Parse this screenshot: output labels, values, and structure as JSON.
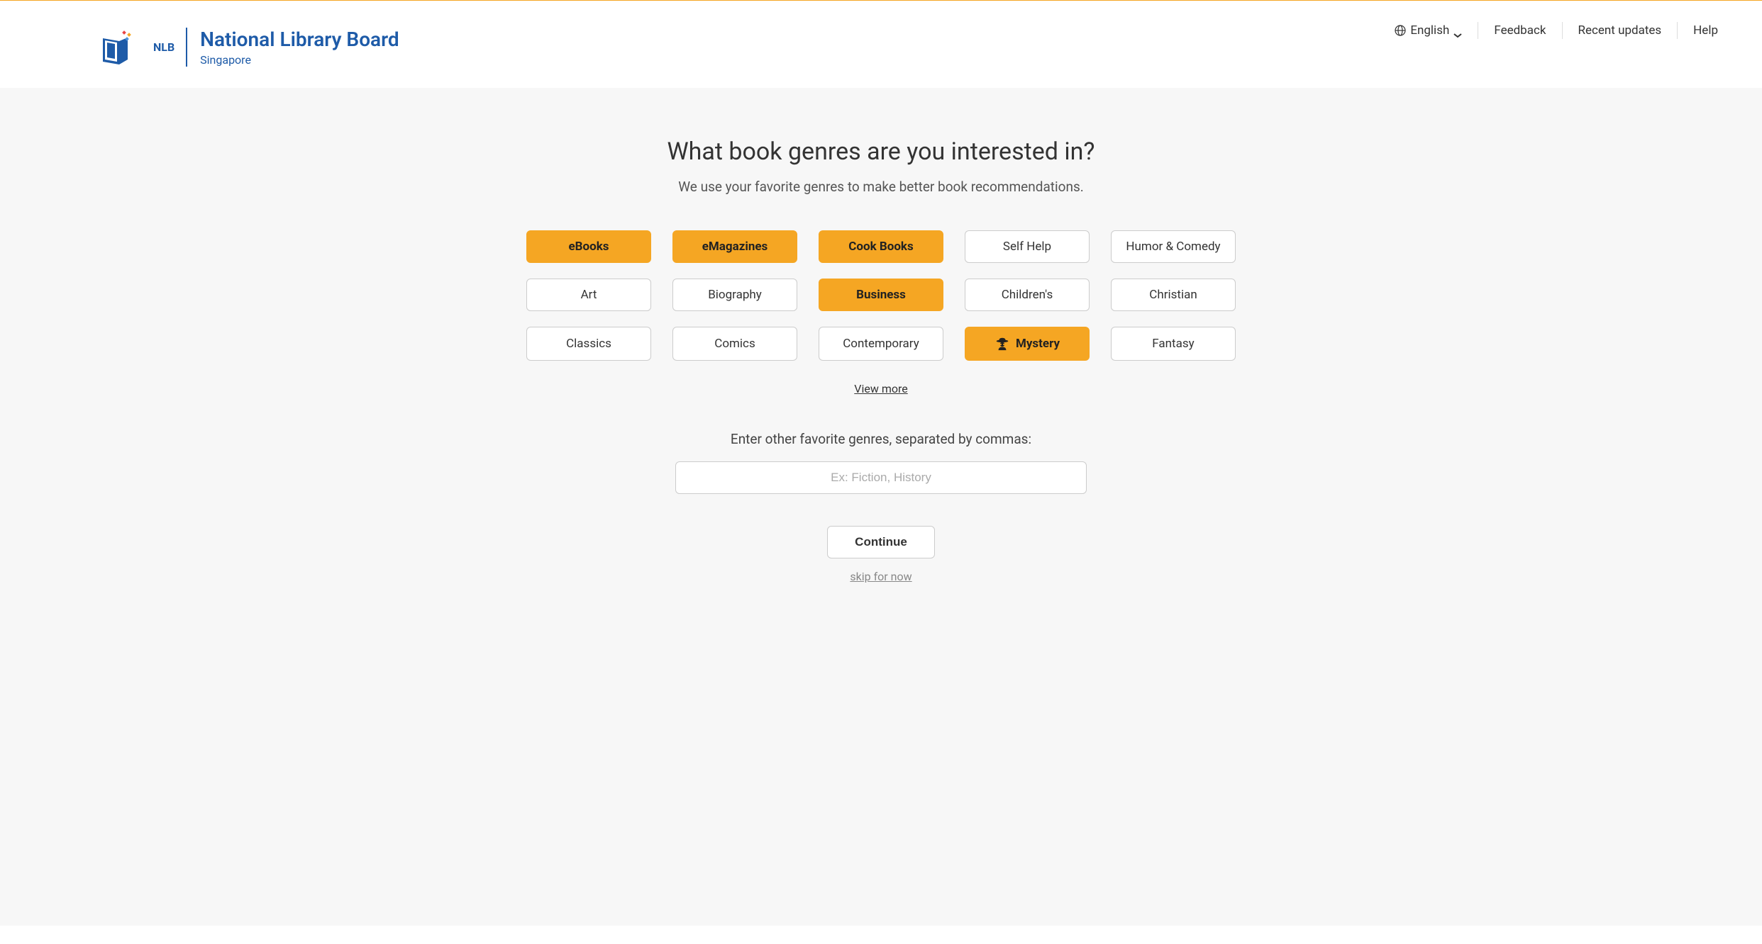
{
  "header": {
    "logo": {
      "abbr": "NLB",
      "main": "National Library Board",
      "sub": "Singapore"
    },
    "nav": {
      "language": "English",
      "feedback": "Feedback",
      "recent_updates": "Recent updates",
      "help": "Help"
    }
  },
  "main": {
    "title": "What book genres are you interested in?",
    "subtitle": "We use your favorite genres to make better book recommendations.",
    "genres": [
      {
        "label": "eBooks",
        "selected": true
      },
      {
        "label": "eMagazines",
        "selected": true
      },
      {
        "label": "Cook Books",
        "selected": true
      },
      {
        "label": "Self Help",
        "selected": false
      },
      {
        "label": "Humor & Comedy",
        "selected": false
      },
      {
        "label": "Art",
        "selected": false
      },
      {
        "label": "Biography",
        "selected": false
      },
      {
        "label": "Business",
        "selected": true
      },
      {
        "label": "Children's",
        "selected": false
      },
      {
        "label": "Christian",
        "selected": false
      },
      {
        "label": "Classics",
        "selected": false
      },
      {
        "label": "Comics",
        "selected": false
      },
      {
        "label": "Contemporary",
        "selected": false
      },
      {
        "label": "Mystery",
        "selected": true,
        "has_icon": true
      },
      {
        "label": "Fantasy",
        "selected": false
      }
    ],
    "view_more": "View more",
    "input_label": "Enter other favorite genres, separated by commas:",
    "input_placeholder": "Ex: Fiction, History",
    "continue_label": "Continue",
    "skip_label": "skip for now"
  }
}
